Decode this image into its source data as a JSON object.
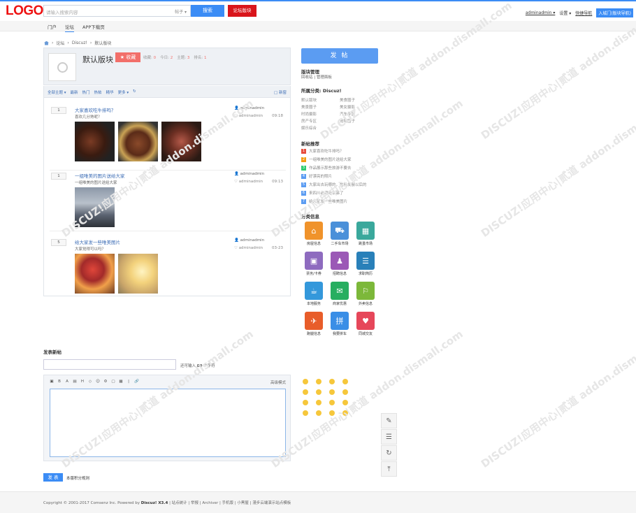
{
  "header": {
    "logo": "LOGO",
    "search_placeholder": "请输入搜索内容",
    "search_scope": "帖子 ▾",
    "search_button": "搜索",
    "forum_button": "论坛版块",
    "user": "adminadmin ▾",
    "settings": "设置 ▾",
    "quick_nav": "快捷导航",
    "enter_city": "入城门(版块导航)"
  },
  "nav": {
    "items": [
      "门户",
      "论坛",
      "APP下载页"
    ]
  },
  "breadcrumb": [
    "论坛",
    "Discuz!",
    "默认版块"
  ],
  "forum": {
    "title": "默认版块",
    "fav_button": "★ 收藏",
    "stats": [
      {
        "label": "收藏:",
        "value": "0"
      },
      {
        "label": "今日:",
        "value": "2"
      },
      {
        "label": "主题:",
        "value": "3"
      },
      {
        "label": "排名:",
        "value": "1"
      }
    ]
  },
  "filters": {
    "items": [
      "全部主题 ▾",
      "最新",
      "热门",
      "热帖",
      "精华",
      "更多 ▾",
      "↻"
    ],
    "new": "□ 新窗"
  },
  "threads": [
    {
      "replies": "1",
      "title": "大家喜欢吃牛排吗？",
      "desc": "喜欢几分熟呢？",
      "author": "adminadmin",
      "last": "adminadmin",
      "time": "09:18"
    },
    {
      "replies": "1",
      "title": "一组唯美的图片送给大家",
      "desc": "一组唯美的图片送给大家",
      "author": "adminadmin",
      "last": "adminadmin",
      "time": "09:13"
    },
    {
      "replies": "5",
      "title": "给大家发一些唯美图片",
      "desc": "大家觉得可以吗？",
      "author": "adminadmin",
      "last": "adminadmin",
      "time": "03-23"
    }
  ],
  "side": {
    "post_button": "发 帖",
    "manage_title": "版块管理",
    "manage_links": "回收站  |  管理面板",
    "cat_title": "所属分类: Discuz!",
    "categories": [
      "默认版块",
      "美食圈子",
      "美景圈子",
      "美女摄影",
      "时尚摄影",
      "汽车专区",
      "房产专区",
      "宠物圈子",
      "娱乐综合"
    ],
    "hot_title": "新帖推荐",
    "hot": [
      "大家喜欢吃牛排吗？",
      "一组唯美的图片送给大家",
      "作品展示那些旅游不要去",
      "好漂亮的照片",
      "大家出去玩哪的，危险发展以后的",
      "来四川必须吃串串了",
      "给大家发一些唯美图片"
    ],
    "hot_colors": [
      "#e74c3c",
      "#f39c12",
      "#2ecc71",
      "#5b9cf2",
      "#5b9cf2",
      "#5b9cf2",
      "#5b9cf2"
    ],
    "apps_title": "分类信息",
    "apps": [
      {
        "label": "房屋信息",
        "color": "#f0932b",
        "icon": "⌂"
      },
      {
        "label": "二手车市场",
        "color": "#4a90d9",
        "icon": "⛟"
      },
      {
        "label": "跳蚤市场",
        "color": "#3aa89c",
        "icon": "▦"
      },
      {
        "label": "票务/卡券",
        "color": "#8e6bbf",
        "icon": "▣"
      },
      {
        "label": "招聘信息",
        "color": "#9b59b6",
        "icon": "♟"
      },
      {
        "label": "求职简历",
        "color": "#2980b9",
        "icon": "☰"
      },
      {
        "label": "本地服务",
        "color": "#3498db",
        "icon": "☕"
      },
      {
        "label": "商家优惠",
        "color": "#27ae60",
        "icon": "✉"
      },
      {
        "label": "外卖信息",
        "color": "#7cb83a",
        "icon": "⚐"
      },
      {
        "label": "跑腿信息",
        "color": "#e85d2a",
        "icon": "✈"
      },
      {
        "label": "我要拼车",
        "color": "#3a8ee6",
        "icon": "拼"
      },
      {
        "label": "同城交友",
        "color": "#e6475a",
        "icon": "♥"
      }
    ]
  },
  "editor": {
    "title": "发表新帖",
    "subject_hint_pre": "还可输入",
    "subject_count": "80",
    "subject_hint_post": "个字符",
    "toolbar": [
      "▣",
      "B",
      "A",
      "▤",
      "H",
      "◇",
      "☺",
      "⚙",
      "▢",
      "▦",
      "|",
      "🔗"
    ],
    "mode": "高级模式",
    "submit": "发 表",
    "rules": "本版积分规则"
  },
  "footer": {
    "copyright": "Copyright © 2001-2017 Comsenz Inc. Powered by",
    "brand": "Discuz! X3.4",
    "links": "| 站点统计 | 举报 | Archiver | 手机版 | 小黑屋 | 漫步云端演示站点模板"
  },
  "watermark": "DISCUZ!应用中心|贰道 addon.dismall.com"
}
